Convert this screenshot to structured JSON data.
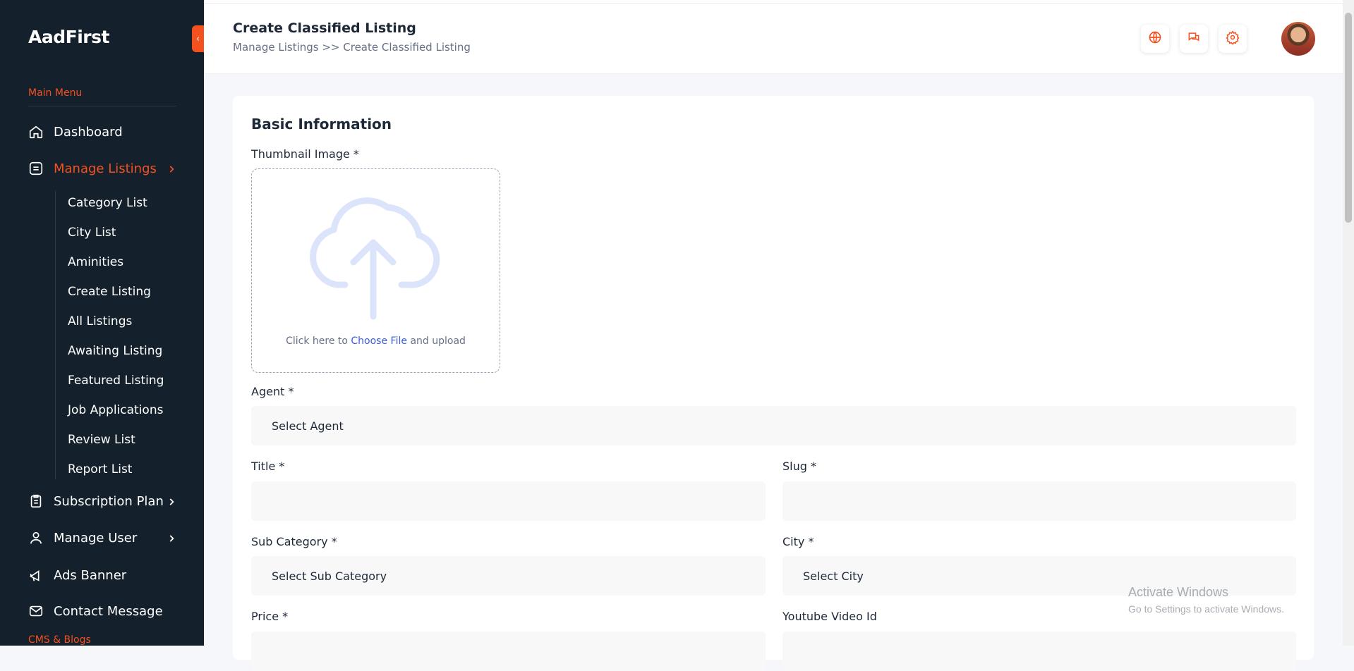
{
  "sidebar": {
    "brand": "AadFirst",
    "collapse_icon": "chevron-left-icon",
    "main_menu_label": "Main Menu",
    "items": [
      {
        "label": "Dashboard",
        "icon": "home-icon"
      },
      {
        "label": "Manage Listings",
        "icon": "list-icon",
        "active": true
      },
      {
        "label": "Subscription Plan",
        "icon": "clipboard-icon"
      },
      {
        "label": "Manage User",
        "icon": "user-icon"
      },
      {
        "label": "Ads Banner",
        "icon": "megaphone-icon"
      },
      {
        "label": "Contact Message",
        "icon": "mail-icon"
      }
    ],
    "sub_items": [
      "Category List",
      "City List",
      "Aminities",
      "Create Listing",
      "All Listings",
      "Awaiting Listing",
      "Featured Listing",
      "Job Applications",
      "Review List",
      "Report List"
    ],
    "cms_section_label": "CMS & Blogs"
  },
  "header": {
    "title": "Create Classified Listing",
    "breadcrumb": "Manage Listings >> Create Classified Listing",
    "icons": [
      "globe-icon",
      "chat-icon",
      "gear-icon"
    ],
    "accent": "#f4511e"
  },
  "form": {
    "section_title": "Basic Information",
    "thumbnail_label": "Thumbnail Image *",
    "upload_prefix": "Click here to",
    "upload_link": "Choose File",
    "upload_suffix": "and upload",
    "agent_label": "Agent *",
    "agent_value": "Select Agent",
    "title_label": "Title *",
    "slug_label": "Slug *",
    "sub_category_label": "Sub Category *",
    "sub_category_value": "Select Sub Category",
    "city_label": "City *",
    "city_value": "Select City",
    "price_label": "Price *",
    "youtube_label": "Youtube Video Id"
  },
  "watermark": {
    "line1": "Activate Windows",
    "line2": "Go to Settings to activate Windows."
  }
}
